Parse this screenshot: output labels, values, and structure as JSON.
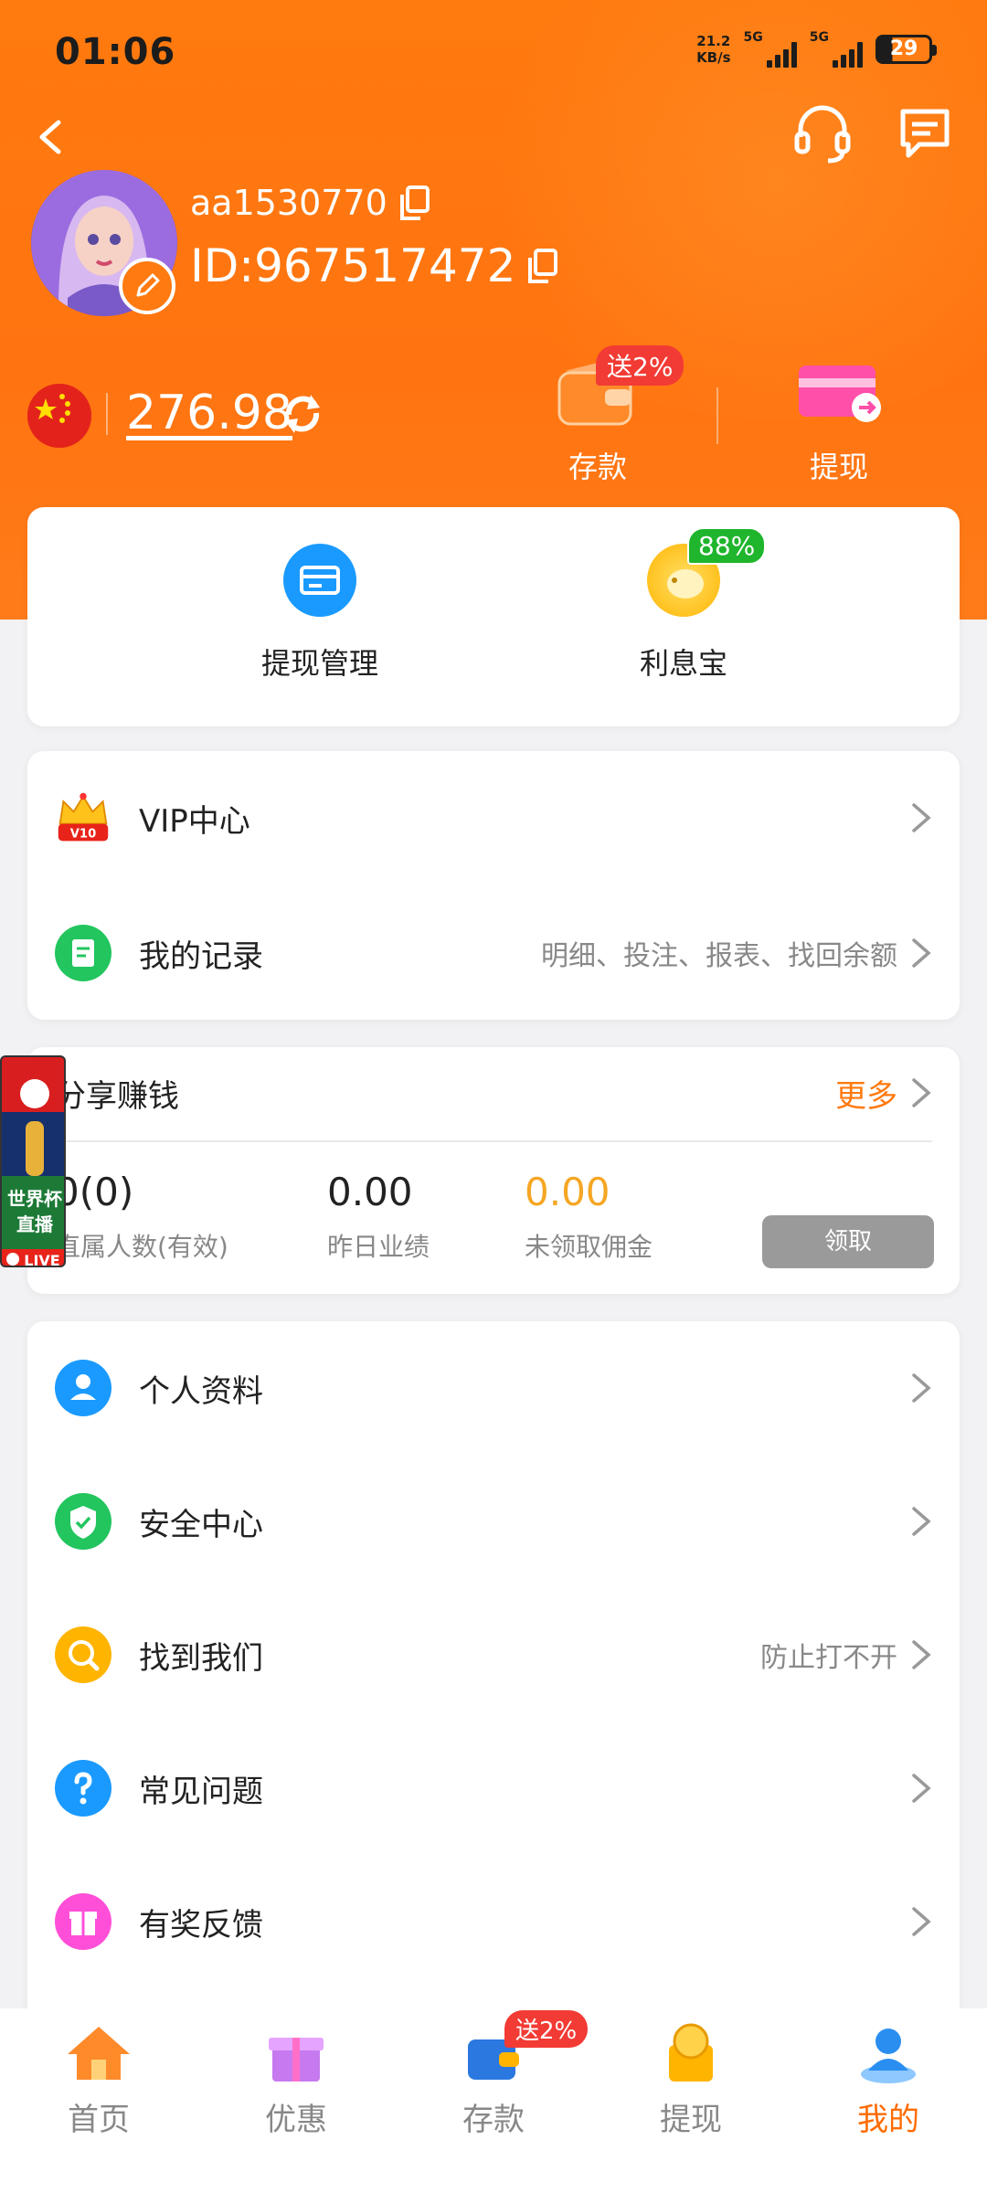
{
  "status_bar": {
    "time": "01:06",
    "net_speed_value": "21.2",
    "net_speed_unit": "KB/s",
    "sim1": "5G",
    "sim2": "5G",
    "battery": "29"
  },
  "user": {
    "username": "aa1530770",
    "id_label": "ID:967517472",
    "balance": "276.98"
  },
  "actions": {
    "deposit_label": "存款",
    "deposit_badge": "送2%",
    "withdraw_label": "提现"
  },
  "quick": {
    "withdraw_manage": "提现管理",
    "interest": "利息宝",
    "interest_badge": "88%"
  },
  "menu1": {
    "vip": {
      "label": "VIP中心",
      "badge": "V10"
    },
    "records": {
      "label": "我的记录",
      "hint": "明细、投注、报表、找回余额"
    }
  },
  "share": {
    "title": "分享赚钱",
    "more": "更多",
    "direct_count": "0(0)",
    "direct_label": "直属人数(有效)",
    "yesterday_value": "0.00",
    "yesterday_label": "昨日业绩",
    "unclaimed_value": "0.00",
    "unclaimed_label": "未领取佣金",
    "claim": "领取"
  },
  "floating": {
    "line1": "世界杯",
    "line2": "直播",
    "live": "LIVE"
  },
  "menu2": [
    {
      "label": "个人资料",
      "hint": ""
    },
    {
      "label": "安全中心",
      "hint": ""
    },
    {
      "label": "找到我们",
      "hint": "防止打不开"
    },
    {
      "label": "常见问题",
      "hint": ""
    },
    {
      "label": "有奖反馈",
      "hint": ""
    }
  ],
  "tabs": {
    "home": "首页",
    "promo": "优惠",
    "deposit": "存款",
    "deposit_badge": "送2%",
    "withdraw": "提现",
    "mine": "我的"
  },
  "colors": {
    "primary": "#ff7a10",
    "deposit_badge": "#f23b34",
    "interest_badge": "#1fb52c"
  }
}
